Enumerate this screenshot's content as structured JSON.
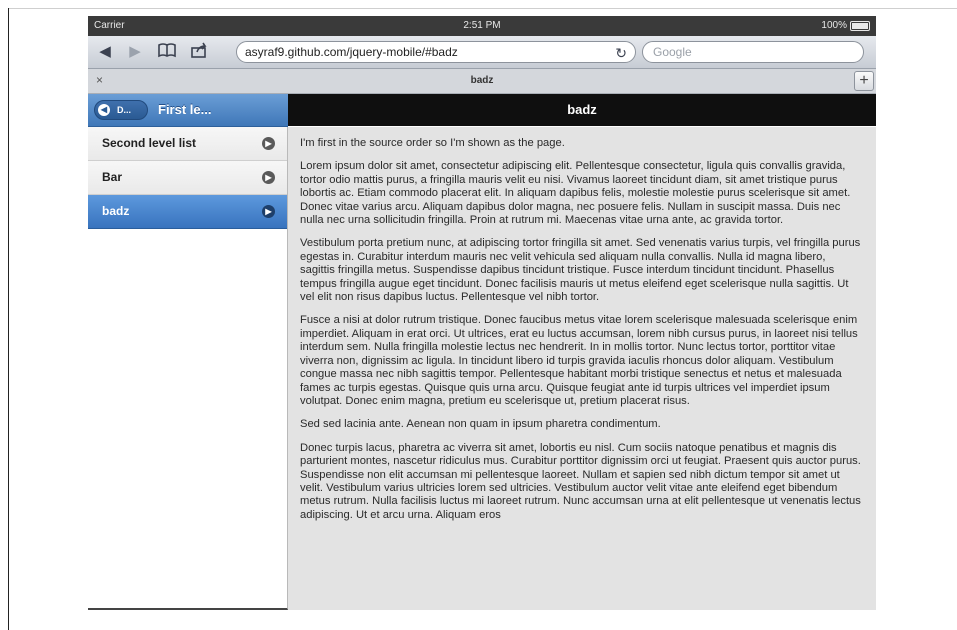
{
  "statusbar": {
    "carrier": "Carrier",
    "time": "2:51 PM",
    "battery": "100%"
  },
  "browser": {
    "url": "asyraf9.github.com/jquery-mobile/#badz",
    "search_placeholder": "Google",
    "tab_title": "badz",
    "tab_close": "×",
    "tab_add": "+"
  },
  "left_header": {
    "back_label": "D...",
    "title": "First le..."
  },
  "list": [
    {
      "label": "Second level list"
    },
    {
      "label": "Bar"
    },
    {
      "label": "badz"
    }
  ],
  "main": {
    "title": "badz",
    "paragraphs": [
      "I'm first in the source order so I'm shown as the page.",
      "Lorem ipsum dolor sit amet, consectetur adipiscing elit. Pellentesque consectetur, ligula quis convallis gravida, tortor odio mattis purus, a fringilla mauris velit eu nisi. Vivamus laoreet tincidunt diam, sit amet tristique purus lobortis ac. Etiam commodo placerat elit. In aliquam dapibus felis, molestie molestie purus scelerisque sit amet. Donec vitae varius arcu. Aliquam dapibus dolor magna, nec posuere felis. Nullam in suscipit massa. Duis nec nulla nec urna sollicitudin fringilla. Proin at rutrum mi. Maecenas vitae urna ante, ac gravida tortor.",
      "Vestibulum porta pretium nunc, at adipiscing tortor fringilla sit amet. Sed venenatis varius turpis, vel fringilla purus egestas in. Curabitur interdum mauris nec velit vehicula sed aliquam nulla convallis. Nulla id magna libero, sagittis fringilla metus. Suspendisse dapibus tincidunt tristique. Fusce interdum tincidunt tincidunt. Phasellus tempus fringilla augue eget tincidunt. Donec facilisis mauris ut metus eleifend eget scelerisque nulla sagittis. Ut vel elit non risus dapibus luctus. Pellentesque vel nibh tortor.",
      "Fusce a nisi at dolor rutrum tristique. Donec faucibus metus vitae lorem scelerisque malesuada scelerisque enim imperdiet. Aliquam in erat orci. Ut ultrices, erat eu luctus accumsan, lorem nibh cursus purus, in laoreet nisi tellus interdum sem. Nulla fringilla molestie lectus nec hendrerit. In in mollis tortor. Nunc lectus tortor, porttitor vitae viverra non, dignissim ac ligula. In tincidunt libero id turpis gravida iaculis rhoncus dolor aliquam. Vestibulum congue massa nec nibh sagittis tempor. Pellentesque habitant morbi tristique senectus et netus et malesuada fames ac turpis egestas. Quisque quis urna arcu. Quisque feugiat ante id turpis ultrices vel imperdiet ipsum volutpat. Donec enim magna, pretium eu scelerisque ut, pretium placerat risus.",
      "Sed sed lacinia ante. Aenean non quam in ipsum pharetra condimentum.",
      "Donec turpis lacus, pharetra ac viverra sit amet, lobortis eu nisl. Cum sociis natoque penatibus et magnis dis parturient montes, nascetur ridiculus mus. Curabitur porttitor dignissim orci ut feugiat. Praesent quis auctor purus. Suspendisse non elit accumsan mi pellentesque laoreet. Nullam et sapien sed nibh dictum tempor sit amet ut velit. Vestibulum varius ultricies lorem sed ultricies. Vestibulum auctor velit vitae ante eleifend eget bibendum metus rutrum. Nulla facilisis luctus mi laoreet rutrum. Nunc accumsan urna at elit pellentesque ut venenatis lectus adipiscing. Ut et arcu urna. Aliquam eros"
    ]
  }
}
